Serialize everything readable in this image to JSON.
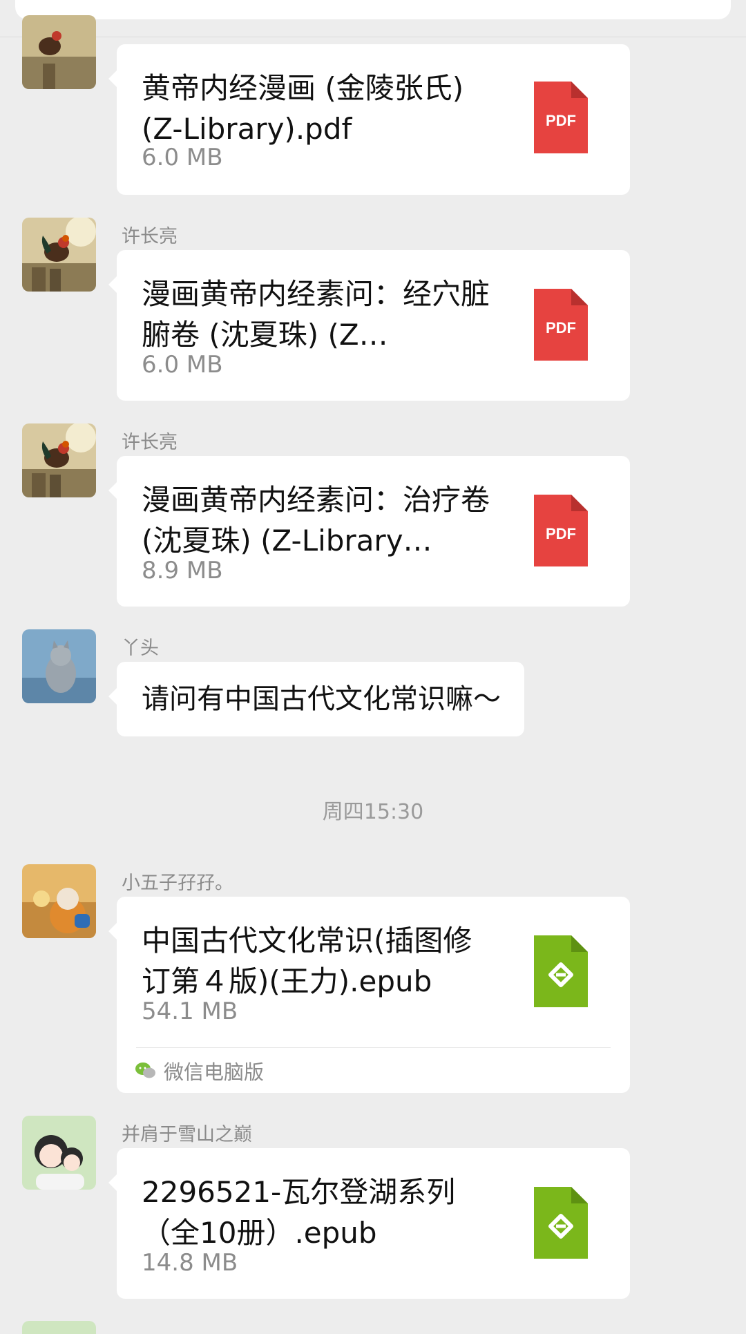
{
  "messages": [
    {
      "sender": "",
      "file_name": "黄帝内经漫画 (金陵张氏)(Z-Library).pdf",
      "file_size": "6.0 MB",
      "file_type": "PDF"
    },
    {
      "sender": "许长亮",
      "file_name": "漫画黄帝内经素问：经穴脏腑卷 (沈夏珠) (Z…",
      "file_size": "6.0 MB",
      "file_type": "PDF"
    },
    {
      "sender": "许长亮",
      "file_name": "漫画黄帝内经素问：治疗卷 (沈夏珠) (Z-Library…",
      "file_size": "8.9 MB",
      "file_type": "PDF"
    },
    {
      "sender": "丫头",
      "text": "请问有中国古代文化常识嘛～"
    },
    {
      "sender": "小五子孖孖。",
      "file_name": "中国古代文化常识(插图修订第４版)(王力).epub",
      "file_size": "54.1 MB",
      "file_type": "epub-icon",
      "source": "微信电脑版"
    },
    {
      "sender": "并肩于雪山之巅",
      "file_name": "2296521-瓦尔登湖系列（全10册）.epub",
      "file_size": "14.8 MB",
      "file_type": "epub-icon"
    }
  ],
  "timestamp": "周四15:30",
  "colors": {
    "pdf": "#e64340",
    "epub": "#7bb71b",
    "background": "#ededed"
  }
}
